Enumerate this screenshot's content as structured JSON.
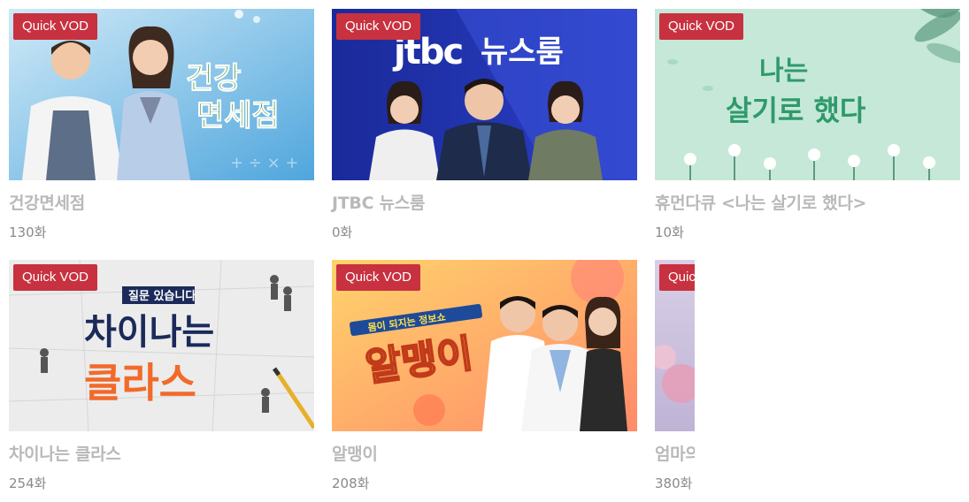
{
  "vod_list": {
    "items": [
      {
        "badge": "Quick VOD",
        "title": "건강면세점",
        "episodes": "130화",
        "thumb_text": [
          "건강",
          "면세점"
        ]
      },
      {
        "badge": "Quick VOD",
        "title": "JTBC 뉴스룸",
        "episodes": "0화",
        "thumb_text": [
          "jtbc",
          "뉴스룸"
        ]
      },
      {
        "badge": "Quick VOD",
        "title": "휴먼다큐 <나는 살기로 했다>",
        "episodes": "10화",
        "thumb_text": [
          "나는",
          "살기로 했다"
        ]
      },
      {
        "badge": "Quick VOD",
        "title": "차이나는 클라스",
        "episodes": "254화",
        "thumb_text": [
          "질문 있습니다",
          "차이나는",
          "클라스"
        ]
      },
      {
        "badge": "Quick VOD",
        "title": "알맹이",
        "episodes": "208화",
        "thumb_text": [
          "몸이 되지는 정보쇼",
          "알맹이"
        ]
      },
      {
        "badge": "Quick VOD",
        "title": "엄마의 봄날",
        "episodes": "380화",
        "thumb_text": []
      }
    ]
  },
  "colors": {
    "badge_bg": "#c8313f",
    "title_text": "#b9b9b9",
    "episode_text": "#8a8a8a"
  }
}
